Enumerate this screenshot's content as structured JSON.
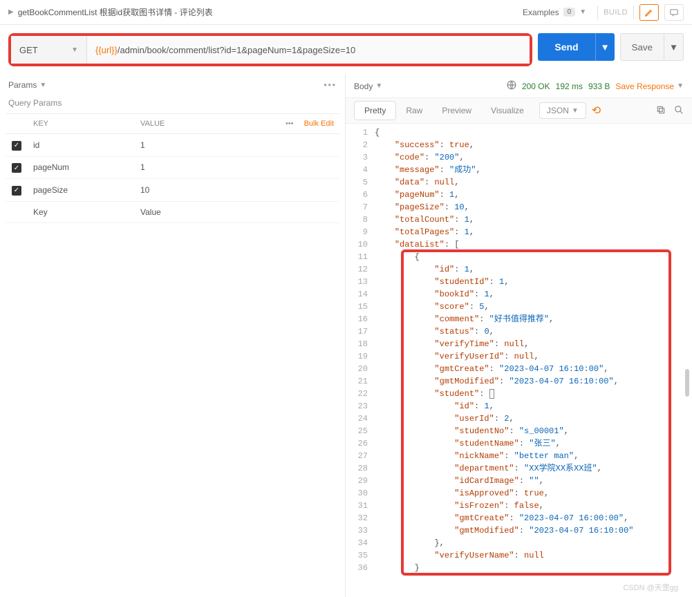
{
  "topbar": {
    "title": "getBookCommentList 根据id获取图书详情 - 评论列表",
    "examples_label": "Examples",
    "examples_count": "0",
    "build_label": "BUILD"
  },
  "request": {
    "method": "GET",
    "url_var": "{{url}}",
    "url_path": "/admin/book/comment/list?id=1&pageNum=1&pageSize=10",
    "send_label": "Send",
    "save_label": "Save"
  },
  "params": {
    "section_label": "Params",
    "sub_label": "Query Params",
    "key_header": "KEY",
    "value_header": "VALUE",
    "bulk_edit": "Bulk Edit",
    "rows": [
      {
        "key": "id",
        "value": "1",
        "checked": true
      },
      {
        "key": "pageNum",
        "value": "1",
        "checked": true
      },
      {
        "key": "pageSize",
        "value": "10",
        "checked": true
      }
    ],
    "key_placeholder": "Key",
    "value_placeholder": "Value"
  },
  "response": {
    "body_label": "Body",
    "status": "200 OK",
    "time": "192 ms",
    "size": "933 B",
    "save_response": "Save Response",
    "tabs": {
      "pretty": "Pretty",
      "raw": "Raw",
      "preview": "Preview",
      "visualize": "Visualize"
    },
    "format": "JSON",
    "json": {
      "success": true,
      "code": "200",
      "message": "成功",
      "data": null,
      "pageNum": 1,
      "pageSize": 10,
      "totalCount": 1,
      "totalPages": 1,
      "dataList": [
        {
          "id": 1,
          "studentId": 1,
          "bookId": 1,
          "score": 5,
          "comment": "好书值得推荐",
          "status": 0,
          "verifyTime": null,
          "verifyUserId": null,
          "gmtCreate": "2023-04-07 16:10:00",
          "gmtModified": "2023-04-07 16:10:00",
          "student": {
            "id": 1,
            "userId": 2,
            "studentNo": "s_00001",
            "studentName": "张三",
            "nickName": "better man",
            "department": "XX学院XX系XX班",
            "idCardImage": "",
            "isApproved": true,
            "isFrozen": false,
            "gmtCreate": "2023-04-07 16:00:00",
            "gmtModified": "2023-04-07 16:10:00"
          },
          "verifyUserName": null
        }
      ]
    }
  },
  "watermark": "CSDN @天罡gg"
}
